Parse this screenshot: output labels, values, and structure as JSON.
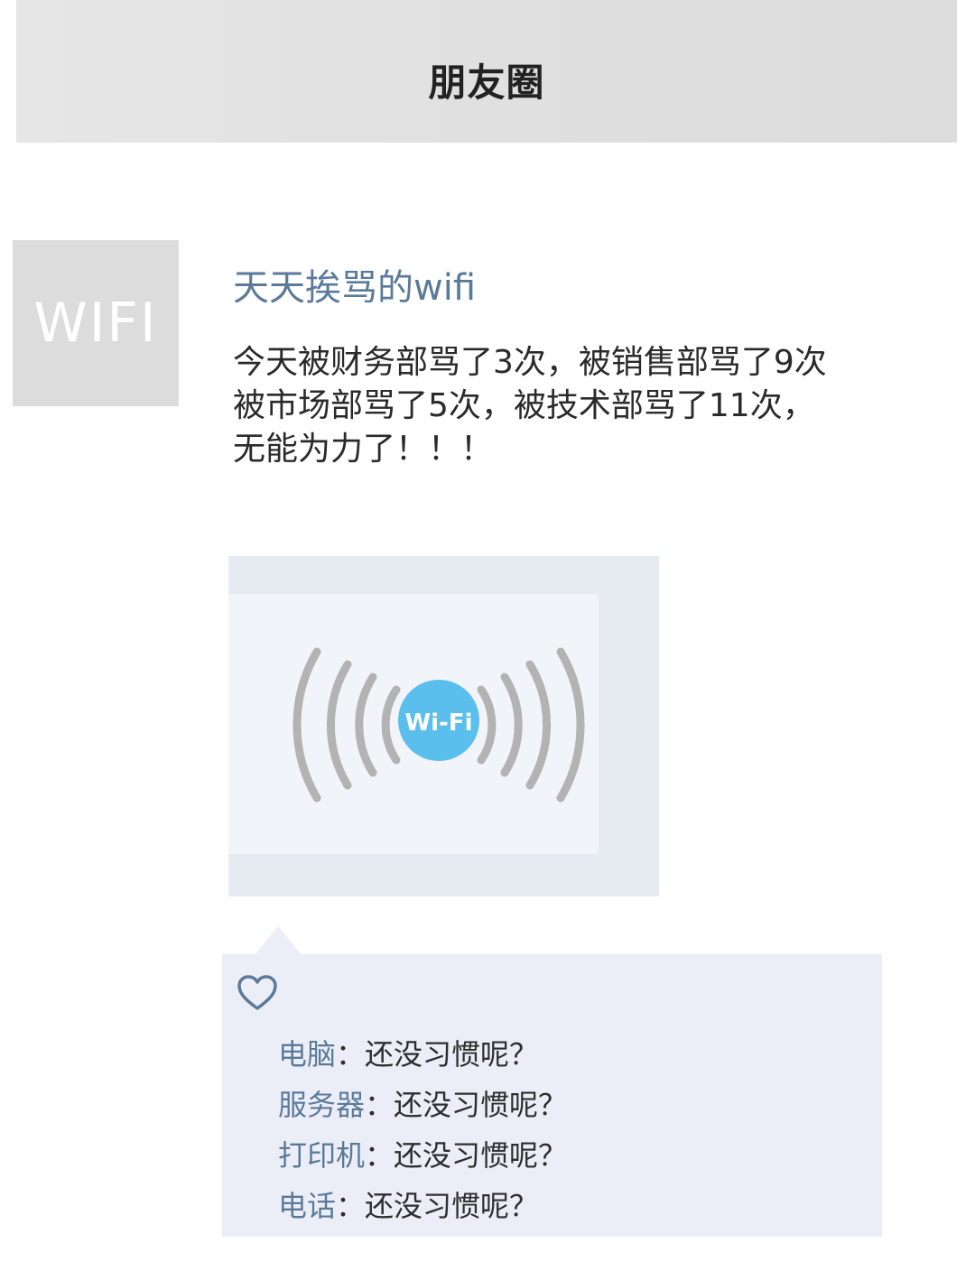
{
  "header": {
    "title": "朋友圈"
  },
  "post": {
    "avatar_text": "WIFI",
    "nickname": "天天挨骂的wifi",
    "text_lines": [
      "今天被财务部骂了3次，被销售部骂了9次",
      "被市场部骂了5次，被技术部骂了11次，",
      "无能为力了！！！"
    ],
    "image_badge": "Wi-Fi"
  },
  "comments": [
    {
      "author": "电脑",
      "separator": "：",
      "text": "还没习惯呢？"
    },
    {
      "author": "服务器",
      "separator": "：",
      "text": "还没习惯呢？"
    },
    {
      "author": "打印机",
      "separator": "：",
      "text": "还没习惯呢？"
    },
    {
      "author": "电话",
      "separator": "：",
      "text": "还没习惯呢？"
    }
  ],
  "colors": {
    "name_blue": "#5b7a9a",
    "wifi_badge": "#5bbfee",
    "arc_gray": "#b3b3b3",
    "comment_bg": "#eceef7"
  }
}
